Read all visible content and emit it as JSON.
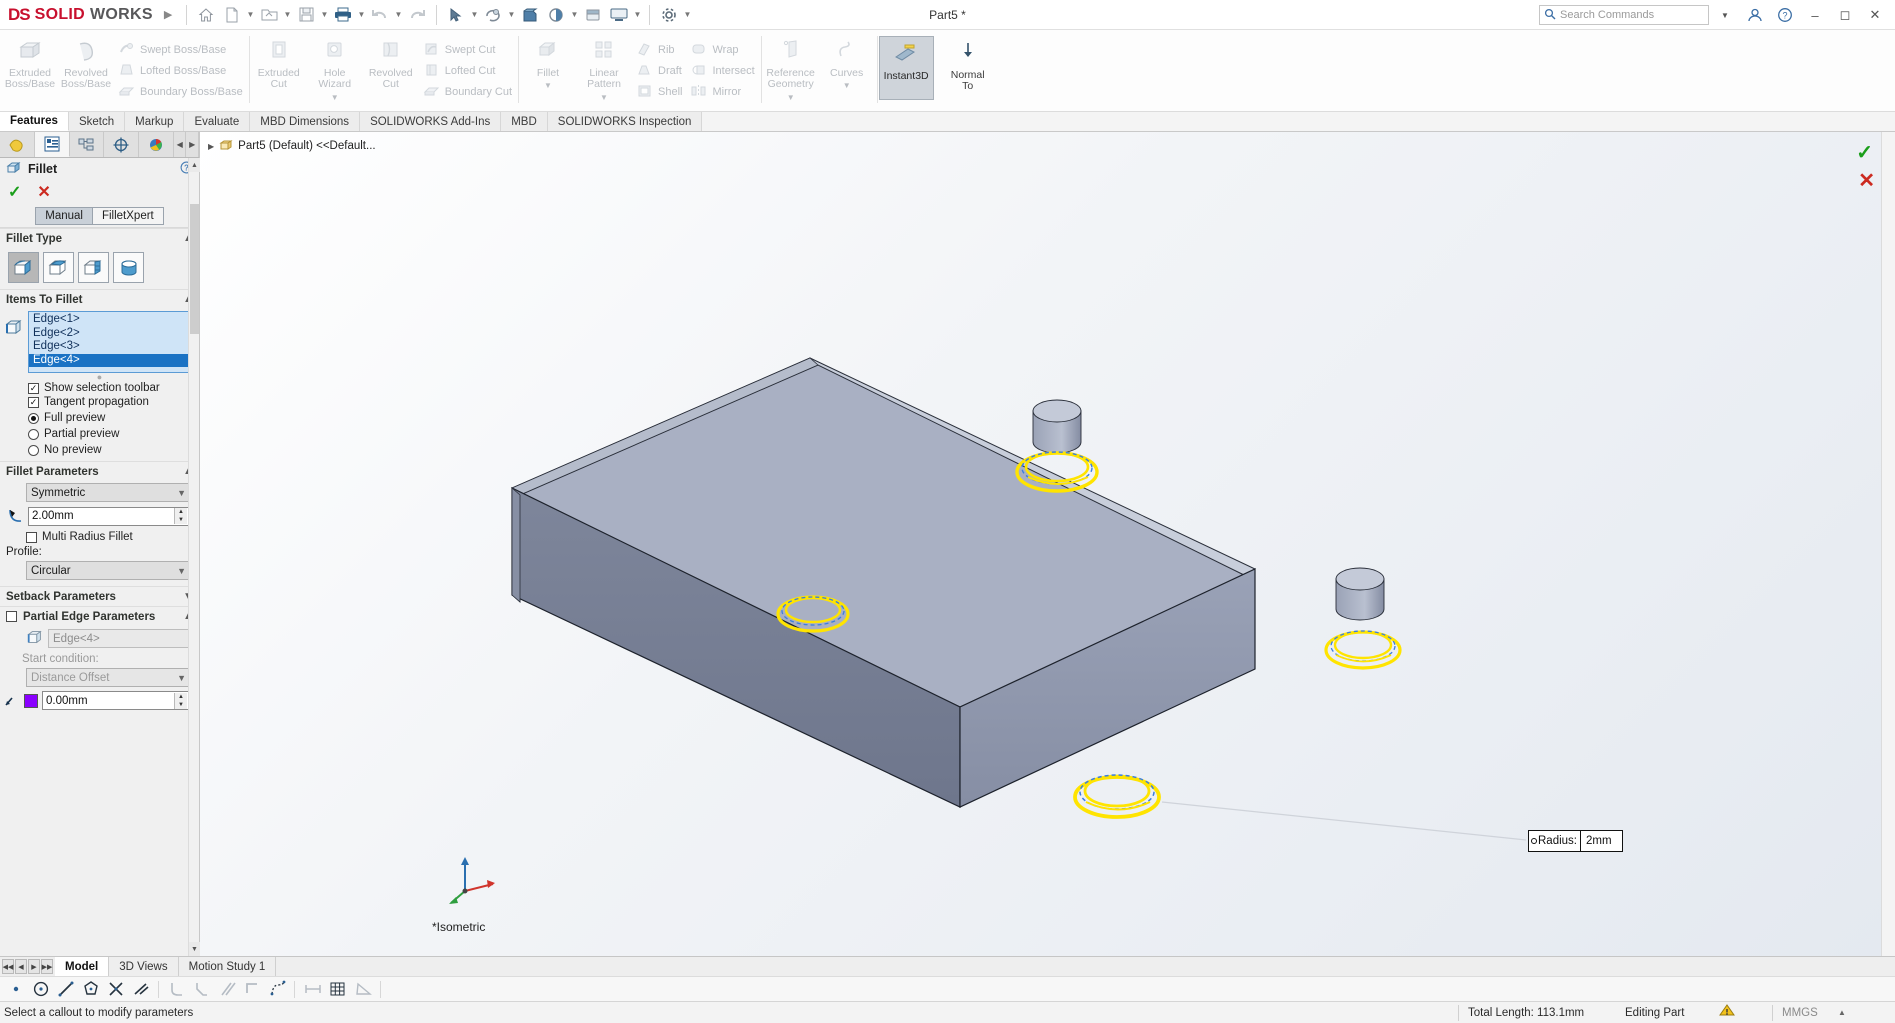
{
  "titlebar": {
    "brand_ds": "DS",
    "brand_solid": "SOLID",
    "brand_works": "WORKS",
    "document_title": "Part5 *",
    "search_placeholder": "Search Commands",
    "icons": [
      "home-icon",
      "new-document-icon",
      "open-folder-icon",
      "save-icon",
      "print-icon",
      "undo-icon",
      "redo-icon",
      "select-icon",
      "rebuild-icon",
      "file-properties-icon",
      "options-icon",
      "customize-icon"
    ],
    "window_controls": [
      "minimize",
      "restore",
      "close"
    ]
  },
  "ribbon": {
    "groups": [
      {
        "name": "boss-base",
        "big": [
          {
            "label": "Extruded\nBoss/Base",
            "enabled": false
          },
          {
            "label": "Revolved\nBoss/Base",
            "enabled": false
          }
        ],
        "small": [
          {
            "label": "Swept Boss/Base",
            "enabled": false
          },
          {
            "label": "Lofted Boss/Base",
            "enabled": false
          },
          {
            "label": "Boundary Boss/Base",
            "enabled": false
          }
        ]
      },
      {
        "name": "cut",
        "big": [
          {
            "label": "Extruded\nCut",
            "enabled": false
          },
          {
            "label": "Hole\nWizard",
            "enabled": false,
            "caret": true
          },
          {
            "label": "Revolved\nCut",
            "enabled": false
          }
        ],
        "small": [
          {
            "label": "Swept Cut",
            "enabled": false
          },
          {
            "label": "Lofted Cut",
            "enabled": false
          },
          {
            "label": "Boundary Cut",
            "enabled": false
          }
        ]
      },
      {
        "name": "features",
        "big": [
          {
            "label": "Fillet",
            "enabled": false,
            "caret": true
          },
          {
            "label": "Linear\nPattern",
            "enabled": false,
            "caret": true
          }
        ],
        "small": [
          {
            "label": "Rib",
            "enabled": false
          },
          {
            "label": "Draft",
            "enabled": false
          },
          {
            "label": "Shell",
            "enabled": false
          }
        ],
        "small2": [
          {
            "label": "Wrap",
            "enabled": false
          },
          {
            "label": "Intersect",
            "enabled": false
          },
          {
            "label": "Mirror",
            "enabled": false
          }
        ]
      },
      {
        "name": "reference",
        "big": [
          {
            "label": "Reference\nGeometry",
            "enabled": false,
            "caret": true
          },
          {
            "label": "Curves",
            "enabled": false,
            "caret": true
          }
        ]
      },
      {
        "name": "instant3d",
        "big": [
          {
            "label": "Instant3D",
            "enabled": true,
            "active": true
          },
          {
            "label": "Normal\nTo",
            "enabled": true
          }
        ]
      }
    ]
  },
  "command_tabs": [
    {
      "label": "Features",
      "active": true
    },
    {
      "label": "Sketch",
      "active": false
    },
    {
      "label": "Markup",
      "active": false
    },
    {
      "label": "Evaluate",
      "active": false
    },
    {
      "label": "MBD Dimensions",
      "active": false
    },
    {
      "label": "SOLIDWORKS Add-Ins",
      "active": false
    },
    {
      "label": "MBD",
      "active": false
    },
    {
      "label": "SOLIDWORKS Inspection",
      "active": false
    }
  ],
  "property_manager": {
    "tabs": [
      "feature-tree-icon",
      "property-manager-icon",
      "configuration-manager-icon",
      "dimxpert-icon",
      "display-manager-icon"
    ],
    "active_tab_index": 1,
    "title": "Fillet",
    "help_icon": "help-icon",
    "ok_label": "✓",
    "cancel_label": "✕",
    "mode_buttons": [
      {
        "label": "Manual",
        "selected": true
      },
      {
        "label": "FilletXpert",
        "selected": false
      }
    ],
    "sections": {
      "fillet_type": {
        "header": "Fillet Type",
        "options": [
          "constant-size-fillet-icon",
          "variable-size-fillet-icon",
          "face-fillet-icon",
          "full-round-fillet-icon"
        ],
        "selected_index": 0
      },
      "items_to_fillet": {
        "header": "Items To Fillet",
        "selection_icon": "edge-selection-icon",
        "edges": [
          {
            "label": "Edge<1>",
            "selected": false
          },
          {
            "label": "Edge<2>",
            "selected": false
          },
          {
            "label": "Edge<3>",
            "selected": false
          },
          {
            "label": "Edge<4>",
            "selected": true
          }
        ],
        "checkboxes": [
          {
            "label": "Show selection toolbar",
            "checked": true
          },
          {
            "label": "Tangent propagation",
            "checked": true
          }
        ],
        "radios": [
          {
            "label": "Full preview",
            "selected": true
          },
          {
            "label": "Partial preview",
            "selected": false
          },
          {
            "label": "No preview",
            "selected": false
          }
        ]
      },
      "fillet_parameters": {
        "header": "Fillet Parameters",
        "symmetry_value": "Symmetric",
        "radius_icon": "radius-icon",
        "radius_value": "2.00mm",
        "multi_radius_label": "Multi Radius Fillet",
        "multi_radius_checked": false,
        "profile_label": "Profile:",
        "profile_value": "Circular"
      },
      "setback_parameters": {
        "header": "Setback Parameters",
        "collapsed": true
      },
      "partial_edge_parameters": {
        "header": "Partial Edge Parameters",
        "checked": false,
        "edge_icon": "edge-selection-icon",
        "edge_value": "Edge<4>",
        "start_condition_label": "Start condition:",
        "start_condition_value": "Distance Offset",
        "offset_value": "0.00mm",
        "offset_color": "#8a00ff"
      }
    }
  },
  "graphics": {
    "feature_tree_root": "Part5 (Default) <<Default...",
    "view_orientation_label": "*Isometric",
    "view_toolbar_icons": [
      "zoom-to-fit-icon",
      "zoom-to-area-icon",
      "zoom-in-out-icon",
      "rotate-view-icon",
      "pan-icon",
      "view-orientation-icon",
      "display-style-icon",
      "hide-show-items-icon",
      "edit-appearance-icon",
      "apply-scene-icon",
      "view-settings-icon"
    ],
    "callout": {
      "label": "Radius:",
      "value": "2mm"
    },
    "confirm_icon": "confirm-check-icon",
    "cancel_icon": "cancel-x-icon",
    "selected_edge_color": "#ffe400",
    "model_face_color": "#9ca3b8"
  },
  "bottom_tabs": [
    {
      "label": "Model",
      "active": true
    },
    {
      "label": "3D Views",
      "active": false
    },
    {
      "label": "Motion Study 1",
      "active": false
    }
  ],
  "sketch_toolbar_icons": [
    "point-icon",
    "circle-icon",
    "line-icon",
    "polygon-icon",
    "trim-icon",
    "extend-icon",
    "fillet-sketch-icon",
    "chamfer-icon",
    "offset-icon",
    "corner-rectangle-icon",
    "spline-icon",
    "smart-dimension-icon",
    "grid-icon",
    "angle-icon"
  ],
  "statusbar": {
    "message": "Select a callout to modify parameters",
    "total_length": "Total Length: 113.1mm",
    "edit_mode": "Editing Part",
    "warning_icon": "warning-icon",
    "units": "MMGS",
    "units_caret": "▲"
  }
}
